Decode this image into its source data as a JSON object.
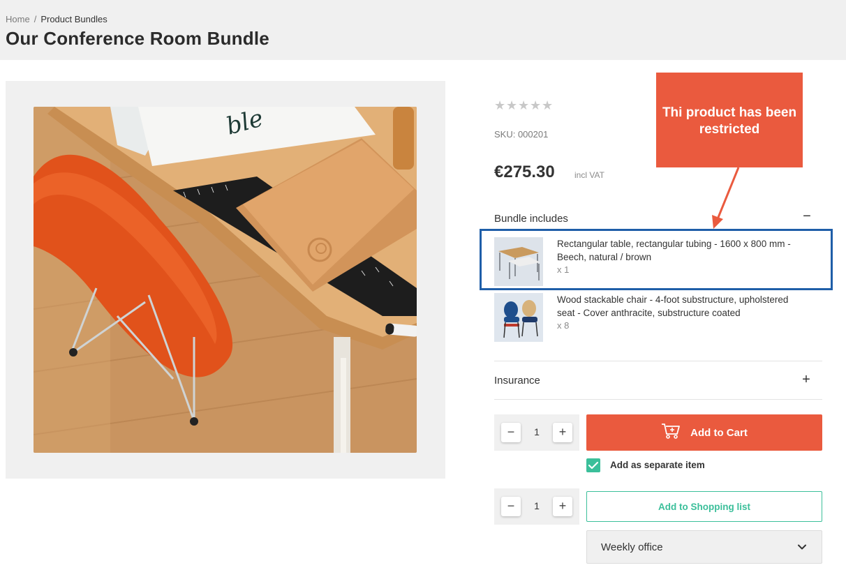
{
  "breadcrumb": {
    "home": "Home",
    "separator": "/",
    "current": "Product Bundles"
  },
  "page": {
    "title": "Our Conference Room Bundle"
  },
  "product": {
    "rating_stars": 5,
    "rating_filled": 0,
    "sku": "SKU: 000201",
    "price": "€275.30",
    "vat_note": "incl VAT"
  },
  "bundle": {
    "heading": "Bundle includes",
    "toggle": "−",
    "items": [
      {
        "name": "Rectangular table, rectangular tubing - 1600 x 800 mm - Beech, natural / brown",
        "qty": "x 1",
        "icon": "table-thumbnail"
      },
      {
        "name": "Wood stackable chair - 4-foot substructure, upholstered seat - Cover anthracite, substructure coated",
        "qty": "x 8",
        "icon": "chair-thumbnail"
      }
    ]
  },
  "insurance": {
    "label": "Insurance",
    "toggle": "+"
  },
  "cart": {
    "quantity": "1",
    "minus": "−",
    "plus": "+",
    "add_to_cart": "Add to Cart",
    "separate_item_label": "Add as separate item",
    "separate_item_checked": true
  },
  "shopping_list": {
    "quantity": "1",
    "minus": "−",
    "plus": "+",
    "add_label": "Add to Shopping list",
    "selected_list": "Weekly office"
  },
  "annotation": {
    "callout_text": "Thi product has been restricted"
  },
  "colors": {
    "accent_red": "#ea5a3e",
    "accent_teal": "#3bbf9a",
    "highlight_blue": "#1f5ea8",
    "panel_gray": "#f0f0f0"
  }
}
